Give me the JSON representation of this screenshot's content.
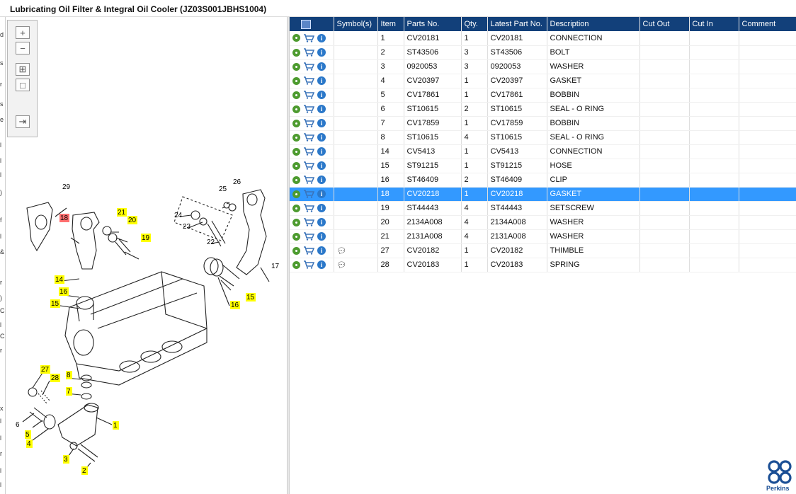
{
  "title": "Lubricating Oil Filter & Integral Oil Cooler (JZ03S001JBHS1004)",
  "left_strip_chars": [
    "d",
    "s",
    "r",
    "s",
    "e",
    "l",
    "l",
    "l",
    ")",
    "f",
    "l",
    "&",
    "r",
    ")",
    "C",
    "l",
    "C",
    "r",
    "x",
    "l",
    "l",
    "r",
    "l",
    "l"
  ],
  "zoom_tools": [
    {
      "name": "zoom-in-icon",
      "glyph": "+"
    },
    {
      "name": "zoom-out-icon",
      "glyph": "−"
    },
    {
      "name": "fit-window-icon",
      "glyph": "⊞"
    },
    {
      "name": "actual-size-icon",
      "glyph": "□"
    },
    {
      "name": "toggle-list-icon",
      "glyph": "⇥"
    }
  ],
  "callouts": [
    {
      "label": "29",
      "style": "plain"
    },
    {
      "label": "18",
      "style": "red"
    },
    {
      "label": "21",
      "style": "yellow"
    },
    {
      "label": "20",
      "style": "yellow"
    },
    {
      "label": "19",
      "style": "yellow"
    },
    {
      "label": "26",
      "style": "plain"
    },
    {
      "label": "25",
      "style": "plain"
    },
    {
      "label": "24",
      "style": "plain"
    },
    {
      "label": "23",
      "style": "plain"
    },
    {
      "label": "22",
      "style": "plain"
    },
    {
      "label": "17",
      "style": "plain"
    },
    {
      "label": "14",
      "style": "yellow"
    },
    {
      "label": "16",
      "style": "yellow"
    },
    {
      "label": "15",
      "style": "yellow"
    },
    {
      "label": "15",
      "style": "yellow"
    },
    {
      "label": "16",
      "style": "yellow"
    },
    {
      "label": "27",
      "style": "yellow"
    },
    {
      "label": "28",
      "style": "yellow"
    },
    {
      "label": "8",
      "style": "yellow"
    },
    {
      "label": "7",
      "style": "yellow"
    },
    {
      "label": "6",
      "style": "plain"
    },
    {
      "label": "5",
      "style": "yellow"
    },
    {
      "label": "4",
      "style": "yellow"
    },
    {
      "label": "1",
      "style": "yellow"
    },
    {
      "label": "3",
      "style": "yellow"
    },
    {
      "label": "2",
      "style": "yellow"
    }
  ],
  "table": {
    "columns": [
      "",
      "Symbol(s)",
      "Item",
      "Parts No.",
      "Qty.",
      "Latest Part No.",
      "Description",
      "Cut Out",
      "Cut In",
      "Comment"
    ],
    "rows": [
      {
        "symbol": "",
        "item": "1",
        "part": "CV20181",
        "qty": "1",
        "latest": "CV20181",
        "desc": "CONNECTION",
        "cut_out": "",
        "cut_in": "",
        "comment": "",
        "selected": false
      },
      {
        "symbol": "",
        "item": "2",
        "part": "ST43506",
        "qty": "3",
        "latest": "ST43506",
        "desc": "BOLT",
        "cut_out": "",
        "cut_in": "",
        "comment": "",
        "selected": false
      },
      {
        "symbol": "",
        "item": "3",
        "part": "0920053",
        "qty": "3",
        "latest": "0920053",
        "desc": "WASHER",
        "cut_out": "",
        "cut_in": "",
        "comment": "",
        "selected": false
      },
      {
        "symbol": "",
        "item": "4",
        "part": "CV20397",
        "qty": "1",
        "latest": "CV20397",
        "desc": "GASKET",
        "cut_out": "",
        "cut_in": "",
        "comment": "",
        "selected": false
      },
      {
        "symbol": "",
        "item": "5",
        "part": "CV17861",
        "qty": "1",
        "latest": "CV17861",
        "desc": "BOBBIN",
        "cut_out": "",
        "cut_in": "",
        "comment": "",
        "selected": false
      },
      {
        "symbol": "",
        "item": "6",
        "part": "ST10615",
        "qty": "2",
        "latest": "ST10615",
        "desc": "SEAL - O RING",
        "cut_out": "",
        "cut_in": "",
        "comment": "",
        "selected": false
      },
      {
        "symbol": "",
        "item": "7",
        "part": "CV17859",
        "qty": "1",
        "latest": "CV17859",
        "desc": "BOBBIN",
        "cut_out": "",
        "cut_in": "",
        "comment": "",
        "selected": false
      },
      {
        "symbol": "",
        "item": "8",
        "part": "ST10615",
        "qty": "4",
        "latest": "ST10615",
        "desc": "SEAL - O RING",
        "cut_out": "",
        "cut_in": "",
        "comment": "",
        "selected": false
      },
      {
        "symbol": "",
        "item": "14",
        "part": "CV5413",
        "qty": "1",
        "latest": "CV5413",
        "desc": "CONNECTION",
        "cut_out": "",
        "cut_in": "",
        "comment": "",
        "selected": false
      },
      {
        "symbol": "",
        "item": "15",
        "part": "ST91215",
        "qty": "1",
        "latest": "ST91215",
        "desc": "HOSE",
        "cut_out": "",
        "cut_in": "",
        "comment": "",
        "selected": false
      },
      {
        "symbol": "",
        "item": "16",
        "part": "ST46409",
        "qty": "2",
        "latest": "ST46409",
        "desc": "CLIP",
        "cut_out": "",
        "cut_in": "",
        "comment": "",
        "selected": false
      },
      {
        "symbol": "",
        "item": "18",
        "part": "CV20218",
        "qty": "1",
        "latest": "CV20218",
        "desc": "GASKET",
        "cut_out": "",
        "cut_in": "",
        "comment": "",
        "selected": true
      },
      {
        "symbol": "",
        "item": "19",
        "part": "ST44443",
        "qty": "4",
        "latest": "ST44443",
        "desc": "SETSCREW",
        "cut_out": "",
        "cut_in": "",
        "comment": "",
        "selected": false
      },
      {
        "symbol": "",
        "item": "20",
        "part": "2134A008",
        "qty": "4",
        "latest": "2134A008",
        "desc": "WASHER",
        "cut_out": "",
        "cut_in": "",
        "comment": "",
        "selected": false
      },
      {
        "symbol": "",
        "item": "21",
        "part": "2131A008",
        "qty": "4",
        "latest": "2131A008",
        "desc": "WASHER",
        "cut_out": "",
        "cut_in": "",
        "comment": "",
        "selected": false
      },
      {
        "symbol": "comment-icon",
        "item": "27",
        "part": "CV20182",
        "qty": "1",
        "latest": "CV20182",
        "desc": "THIMBLE",
        "cut_out": "",
        "cut_in": "",
        "comment": "",
        "selected": false
      },
      {
        "symbol": "comment-icon",
        "item": "28",
        "part": "CV20183",
        "qty": "1",
        "latest": "CV20183",
        "desc": "SPRING",
        "cut_out": "",
        "cut_in": "",
        "comment": "",
        "selected": false
      }
    ]
  },
  "logo_text": "Perkins",
  "colors": {
    "header": "#12407a",
    "selected_row": "#3399ff",
    "callout_yellow": "#ffff00",
    "callout_red": "#ff6f6f",
    "brand": "#1b4f95"
  }
}
